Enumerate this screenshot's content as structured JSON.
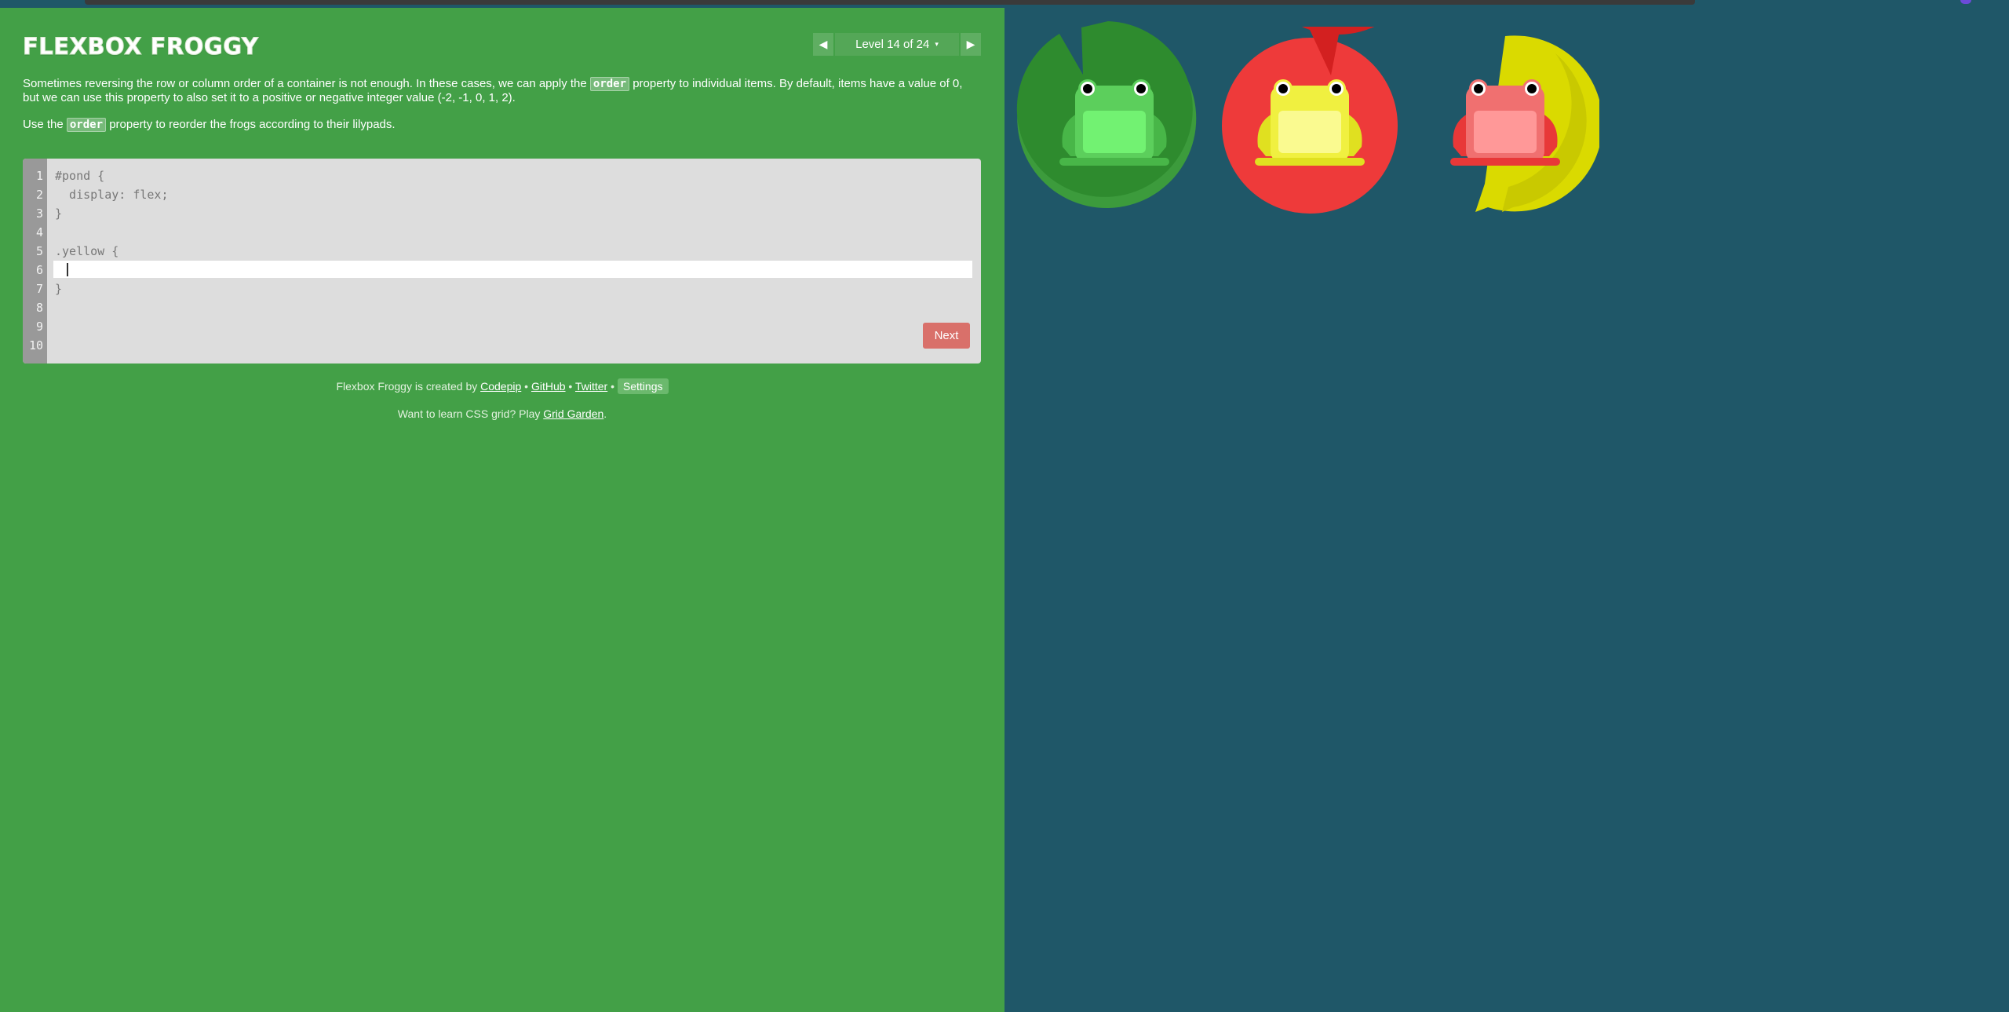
{
  "app": {
    "title": "FLEXBOX FROGGY"
  },
  "level_nav": {
    "label": "Level 14 of 24",
    "caret": "▾",
    "prev_symbol": "◀",
    "next_symbol": "▶"
  },
  "instructions": {
    "p1_before": "Sometimes reversing the row or column order of a container is not enough. In these cases, we can apply the ",
    "p1_code": "order",
    "p1_after": " property to individual items. By default, items have a value of 0, but we can use this property to also set it to a positive or negative integer value (-2, -1, 0, 1, 2).",
    "p2_before": "Use the ",
    "p2_code": "order",
    "p2_after": " property to reorder the frogs according to their lilypads."
  },
  "editor": {
    "line_numbers": [
      "1",
      "2",
      "3",
      "4",
      "5",
      "6",
      "7",
      "8",
      "9",
      "10"
    ],
    "lines": [
      "#pond {",
      "  display: flex;",
      "}",
      "",
      ".yellow {",
      "",
      "}",
      "",
      "",
      ""
    ],
    "input_value": "",
    "next_label": "Next"
  },
  "footer": {
    "credits_prefix": "Flexbox Froggy is created by ",
    "codepip": "Codepip",
    "sep1": " • ",
    "github": "GitHub",
    "sep2": " • ",
    "twitter": "Twitter",
    "sep3": " • ",
    "settings": "Settings",
    "promo_prefix": "Want to learn CSS grid? Play ",
    "grid_garden": "Grid Garden",
    "promo_suffix": "."
  },
  "pond": {
    "lilypads": [
      {
        "color": "green",
        "fill": "#2e8b2e",
        "shade": "#3c9b3c"
      },
      {
        "color": "red",
        "fill": "#d32020",
        "shade": "#ee3a3a"
      },
      {
        "color": "yellow",
        "fill": "#dada00",
        "shade": "#c9c900"
      }
    ],
    "frogs": [
      {
        "color": "green",
        "body": "#5ccf5c",
        "belly": "#72f272",
        "legs": "#48b648"
      },
      {
        "color": "yellow",
        "body": "#f0f040",
        "belly": "#fafa90",
        "legs": "#e0e020"
      },
      {
        "color": "red",
        "body": "#f07070",
        "belly": "#ff9898",
        "legs": "#e83838"
      }
    ]
  }
}
